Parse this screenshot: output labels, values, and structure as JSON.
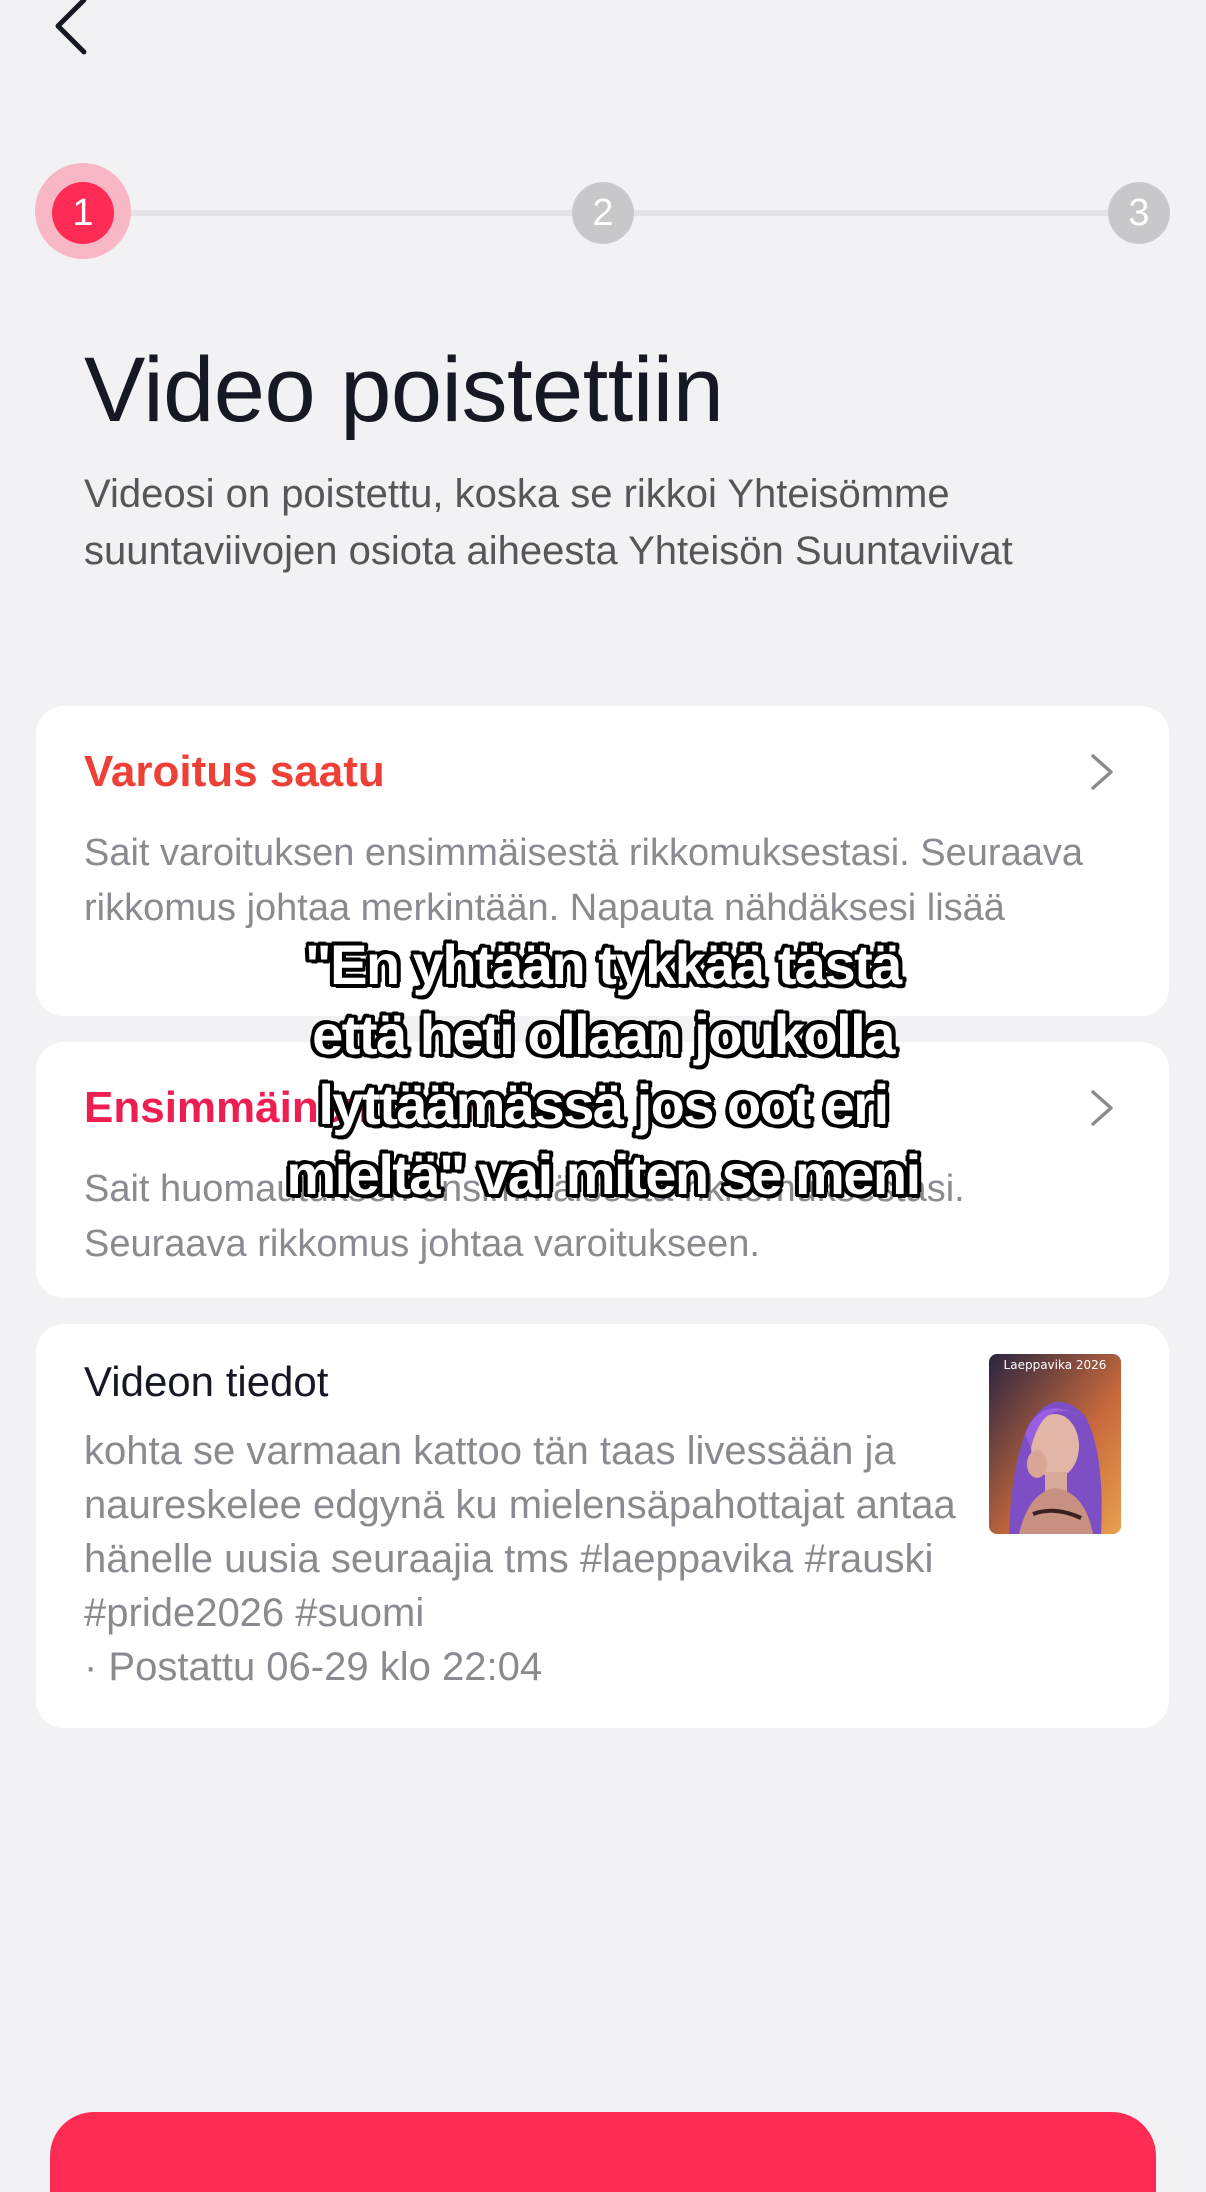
{
  "nav": {
    "back_icon": "chevron-left-icon"
  },
  "stepper": {
    "steps": [
      "1",
      "2",
      "3"
    ],
    "active_step": 1,
    "active_color": "#fe2c55",
    "inactive_color": "#c8c8cb"
  },
  "header": {
    "title": "Video poistettiin",
    "subtitle": "Videosi on poistettu, koska se rikkoi Yhteisömme suuntaviivojen osiota aiheesta Yhteisön Suuntaviivat"
  },
  "cards": {
    "warning": {
      "title": "Varoitus saatu",
      "text": "Sait varoituksen ensimmäisestä rikkomuksestasi. Seuraava rikkomus johtaa merkintään. Napauta nähdäksesi lisää",
      "title_color": "#ee4036",
      "chevron_icon": "chevron-right-icon"
    },
    "notice": {
      "title": "Ensimmäinen huomautus",
      "text": "Sait huomautuksen ensimmäisestä rikkomuksestasi. Seuraava rikkomus johtaa varoitukseen.",
      "title_color": "#ee1d52",
      "chevron_icon": "chevron-right-icon"
    },
    "video_info": {
      "title": "Videon tiedot",
      "description": "kohta se varmaan kattoo tän taas livessään ja naureskelee edgynä ku mielensäpahottajat antaa hänelle uusia seuraajia tms #laeppavika #rauski #pride2026 #suomi",
      "posted": "· Postattu 06-29 klo 22:04",
      "thumbnail_caption": "Laeppavika 2026"
    }
  },
  "overlay_caption": {
    "lines": [
      "\"En yhtään tykkää tästä",
      "että heti ollaan joukolla",
      "lyttäämässä jos oot eri",
      "mieltä\" vai miten se meni"
    ]
  },
  "bottom_button": {
    "color": "#fe2c55"
  }
}
